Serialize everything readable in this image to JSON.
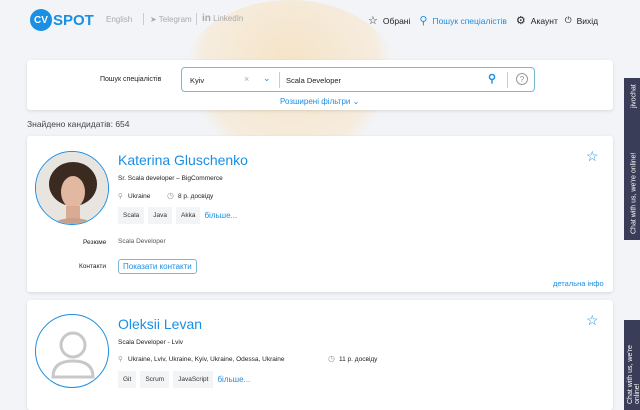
{
  "header": {
    "logo_mark": "CV",
    "logo_text": "SPOT",
    "language": "English",
    "telegram": "Telegram",
    "linkedin": "LinkedIn",
    "nav": {
      "favorites": "Обрані",
      "search": "Пошук спеціалістів",
      "account": "Акаунт",
      "logout": "Вихід"
    }
  },
  "search": {
    "label": "Пошук спеціалістів",
    "city": "Kyiv",
    "query": "Scala Developer",
    "advanced": "Розширені фільтри"
  },
  "found": "Знайдено кандидатів: 654",
  "candidates": [
    {
      "name": "Katerina Gluschenko",
      "title": "Sr. Scala developer – BigCommerce",
      "location": "Ukraine",
      "experience": "8 р. досвіду",
      "tags": [
        "Scala",
        "Java",
        "Akka"
      ],
      "more": "більше...",
      "resume_label": "Резюме",
      "resume": "Scala Developer",
      "contacts_label": "Контакти",
      "show_contacts": "Показати контакти",
      "details": "детальна інфо"
    },
    {
      "name": "Oleksii Levan",
      "title": "Scala Developer - Lviv",
      "location": "Ukraine, Lviv, Ukraine, Kyiv, Ukraine, Odessa, Ukraine",
      "experience": "11 р. досвіду",
      "tags": [
        "Git",
        "Scrum",
        "JavaScript"
      ],
      "more": "більше..."
    }
  ],
  "chat": {
    "text": "Chat with us, we're online!",
    "brand": "jivochat"
  }
}
